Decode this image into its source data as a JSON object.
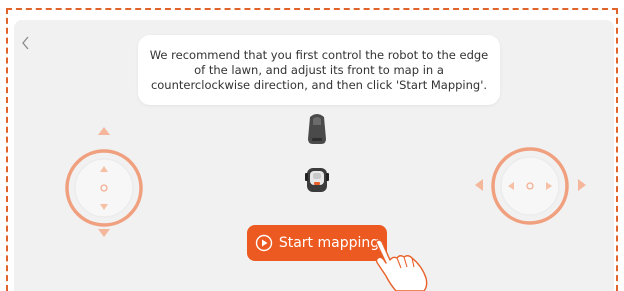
{
  "instruction": {
    "text": "We recommend that you first control the robot to the edge of the lawn, and adjust its front to map in a counterclockwise direction, and then click 'Start Mapping'."
  },
  "start_button": {
    "label": "Start mapping"
  },
  "icons": {
    "back": "chevron-left-icon",
    "play": "play-circle-icon",
    "hand": "pointing-hand-icon",
    "mower_front": "robot-mower-front-view-icon",
    "mower_top": "robot-mower-top-view-icon"
  },
  "colors": {
    "accent": "#ec5a22",
    "frame_dash": "#e0632b",
    "panel_bg": "#f1f1f1",
    "joystick_ring": "#f0a07e",
    "text": "#333333"
  }
}
